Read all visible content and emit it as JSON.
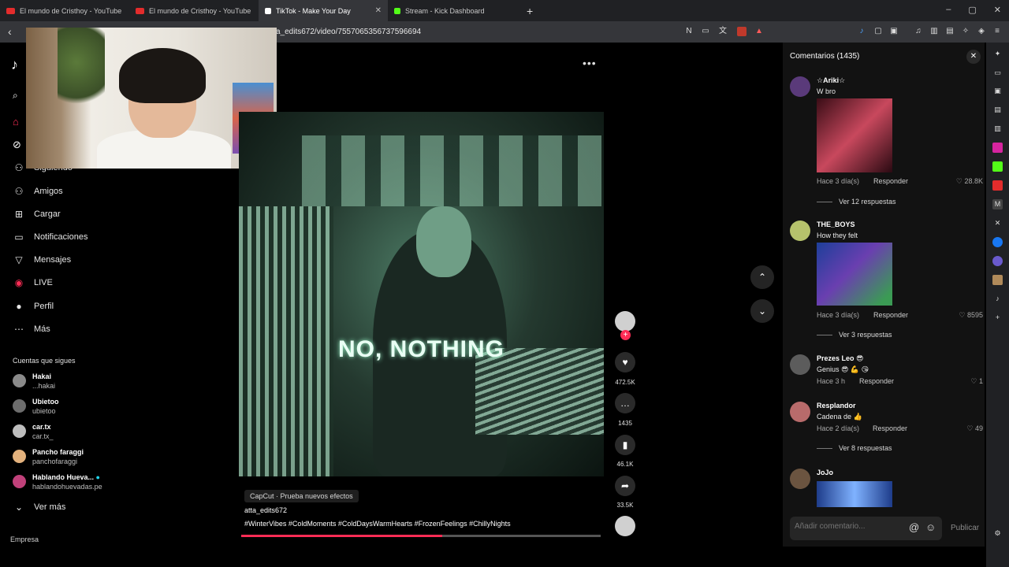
{
  "browser": {
    "tabs": [
      {
        "title": "El mundo de Cristhoy - YouTube",
        "color": "#e32c2c",
        "active": false
      },
      {
        "title": "El mundo de Cristhoy - YouTube",
        "color": "#e32c2c",
        "active": false
      },
      {
        "title": "TikTok - Make Your Day",
        "color": "#ffffff",
        "active": true
      },
      {
        "title": "Stream - Kick Dashboard",
        "color": "#53fc18",
        "active": false
      }
    ],
    "new_tab": "+",
    "url": "a_edits672/video/7557065356737596694",
    "window_controls": [
      "–",
      "▢",
      "✕"
    ]
  },
  "sidebar": {
    "nav": [
      {
        "label": "Siguiendo",
        "icon": "person-icon"
      },
      {
        "label": "Amigos",
        "icon": "friends-icon"
      },
      {
        "label": "Cargar",
        "icon": "upload-icon"
      },
      {
        "label": "Notificaciones",
        "icon": "notifications-icon"
      },
      {
        "label": "Mensajes",
        "icon": "messages-icon"
      },
      {
        "label": "LIVE",
        "icon": "live-icon"
      },
      {
        "label": "Perfil",
        "icon": "profile-icon"
      },
      {
        "label": "Más",
        "icon": "more-icon"
      }
    ],
    "following_title": "Cuentas que sigues",
    "accounts": [
      {
        "name": "Hakai",
        "handle": "...hakai",
        "color": "#8a8a8a"
      },
      {
        "name": "Ubietoo",
        "handle": "ubietoo",
        "color": "#6d6d6d"
      },
      {
        "name": "car.tx",
        "handle": "car.tx_",
        "color": "#bdbdbd"
      },
      {
        "name": "Pancho faraggi",
        "handle": "panchofaraggi",
        "color": "#e3b27d"
      },
      {
        "name": "Hablando Huevа...",
        "handle": "hablandohuevadas.pe",
        "color": "#c0417a",
        "verified": true
      }
    ],
    "see_more": "Ver más",
    "company": "Empresa"
  },
  "video": {
    "overlay_text": "NO, NOTHING",
    "likes": "472.5K",
    "comments": "1435",
    "saves": "46.1K",
    "shares": "33.5K",
    "capcut_label": "CapCut · Prueba nuevos efectos",
    "author": "atta_edits672",
    "hashtags": "#WinterVibes #ColdMoments #ColdDaysWarmHearts #FrozenFeelings #ChillyNights",
    "progress": 0.56,
    "accent": "#fe2c55"
  },
  "comments": {
    "title": "Comentarios (1435)",
    "items": [
      {
        "user": "☆Ariki☆",
        "text": "W bro",
        "time": "Hace 3 día(s)",
        "reply": "Responder",
        "likes": "28.8K",
        "more": "Ver 12 respuestas",
        "color": "#5a3a7a",
        "has_image": true
      },
      {
        "user": "THE_BOYS",
        "text": "How they felt",
        "time": "Hace 3 día(s)",
        "reply": "Responder",
        "likes": "8595",
        "more": "Ver 3 respuestas",
        "color": "#b6c26c",
        "has_image": true
      },
      {
        "user": "Prezes Leo 😎",
        "text": "Genius 😎 💪 😘",
        "time": "Hace 3 h",
        "reply": "Responder",
        "likes": "1",
        "color": "#5c5c5c"
      },
      {
        "user": "Resplandor",
        "text": "Cadena de 👍",
        "time": "Hace 2 día(s)",
        "reply": "Responder",
        "likes": "49",
        "more": "Ver 8 respuestas",
        "color": "#b86b6b"
      },
      {
        "user": "JoJo",
        "text": "",
        "color": "#6b5440"
      }
    ],
    "input_placeholder": "Añadir comentario...",
    "publish": "Publicar"
  }
}
